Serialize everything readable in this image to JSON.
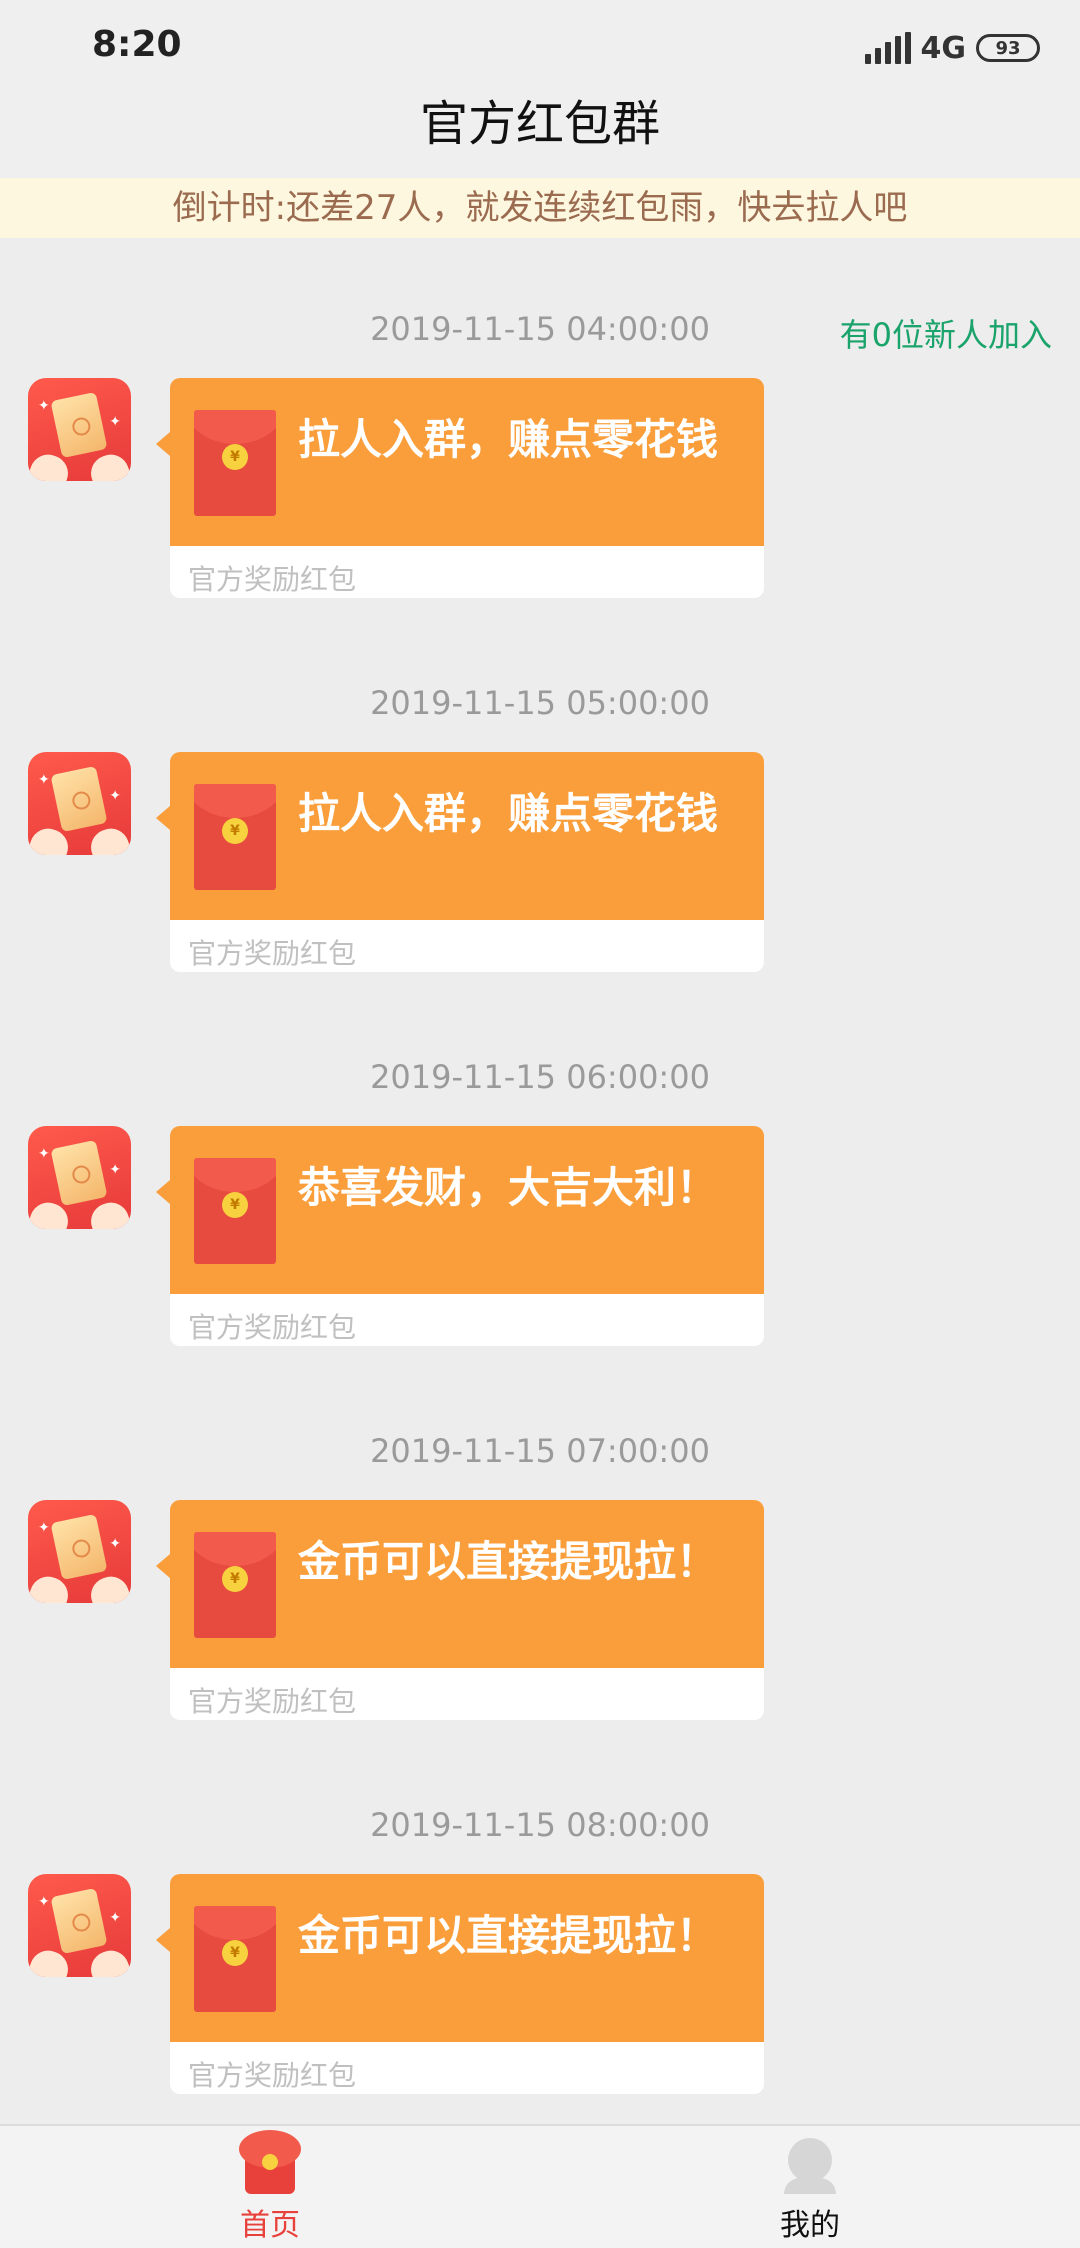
{
  "status_bar": {
    "time": "8:20",
    "network": "4G",
    "battery": "93"
  },
  "header": {
    "title": "官方红包群"
  },
  "banner": {
    "text": "倒计时:还差27人，就发连续红包雨，快去拉人吧"
  },
  "new_members_text": "有0位新人加入",
  "messages": [
    {
      "timestamp": "2019-11-15 04:00:00",
      "text": "拉人入群，赚点零花钱",
      "footer": "官方奖励红包"
    },
    {
      "timestamp": "2019-11-15 05:00:00",
      "text": "拉人入群，赚点零花钱",
      "footer": "官方奖励红包"
    },
    {
      "timestamp": "2019-11-15 06:00:00",
      "text": "恭喜发财，大吉大利！",
      "footer": "官方奖励红包"
    },
    {
      "timestamp": "2019-11-15 07:00:00",
      "text": "金币可以直接提现拉！",
      "footer": "官方奖励红包"
    },
    {
      "timestamp": "2019-11-15 08:00:00",
      "text": "金币可以直接提现拉！",
      "footer": "官方奖励红包"
    }
  ],
  "bottom_nav": {
    "home_label": "首页",
    "me_label": "我的"
  },
  "colors": {
    "bubble": "#f99e3a",
    "accent_red": "#e8403a",
    "green": "#1aa36b"
  },
  "icons": [
    "red-packet-avatar-icon",
    "red-packet-icon",
    "home-icon",
    "profile-icon",
    "signal-icon",
    "battery-icon"
  ]
}
